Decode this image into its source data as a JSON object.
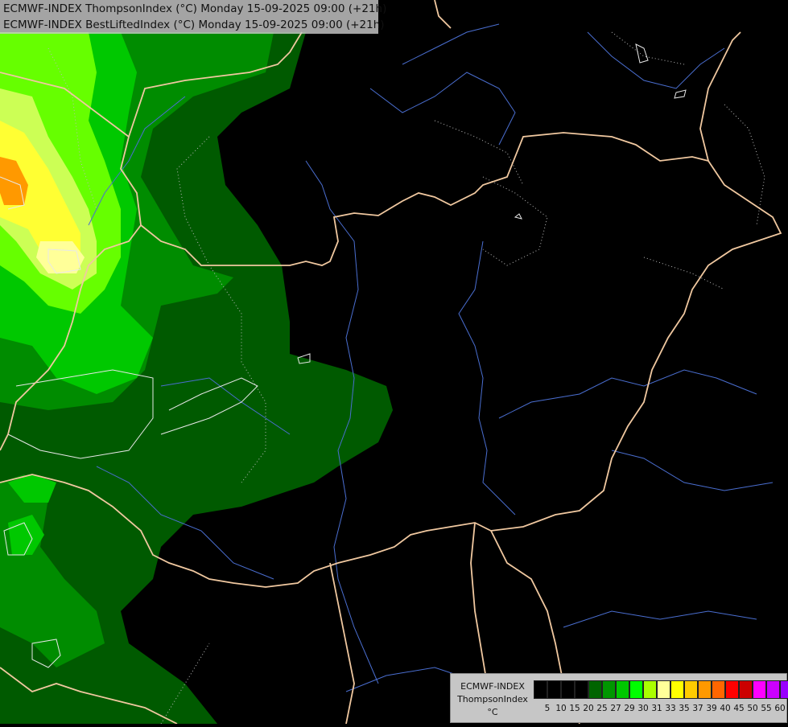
{
  "header": {
    "line1": "ECMWF-INDEX ThompsonIndex (°C) Monday 15-09-2025 09:00 (+21h)",
    "line2": "ECMWF-INDEX BestLiftedIndex (°C) Monday 15-09-2025 09:00 (+21h)"
  },
  "legend": {
    "title1": "ECMWF-INDEX",
    "title2": "ThompsonIndex",
    "unit": "°C",
    "colors": [
      "#000000",
      "#000000",
      "#000000",
      "#000000",
      "#006400",
      "#009600",
      "#00c800",
      "#00ff00",
      "#aaff00",
      "#ffff99",
      "#ffff00",
      "#ffcc00",
      "#ff9900",
      "#ff6600",
      "#ff0000",
      "#cc0000",
      "#ff00ff",
      "#cc00ff",
      "#9900ff",
      "#6600ff",
      "#0000ff"
    ],
    "ticks": [
      "5",
      "10",
      "15",
      "20",
      "25",
      "27",
      "29",
      "30",
      "31",
      "33",
      "35",
      "37",
      "39",
      "40",
      "45",
      "50",
      "55",
      "60"
    ]
  },
  "map": {
    "field": "ThompsonIndex",
    "overlay": "BestLiftedIndex contours",
    "palette": {
      "dark_green": "#005a00",
      "green": "#008c00",
      "bright_green": "#00c800",
      "lime": "#7cff00",
      "yellow": "#ffff66",
      "orange": "#ff9900",
      "border": "#f0c8a0",
      "river": "#4a6ed0",
      "contour": "#d0d0d0"
    }
  }
}
